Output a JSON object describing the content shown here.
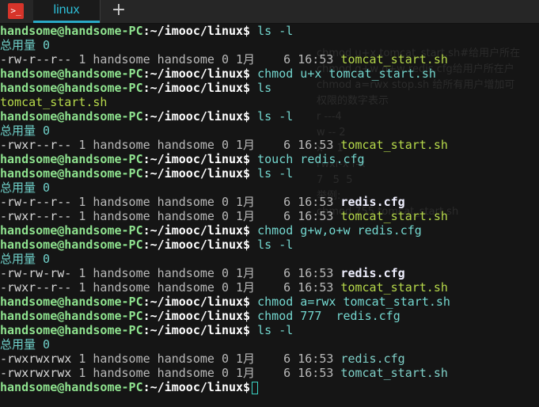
{
  "window": {
    "tab_label": "linux",
    "app_icon_glyph": ">_",
    "new_tab_glyph": "+"
  },
  "prompt": {
    "user_host": "handsome@handsome-PC",
    "path": ":~/imooc/linux$"
  },
  "background_notes": [
    "chmod u+x tomcat_start.sh#给用户所在",
    "chmod g+w,o+w redis.cfg给用户所在户",
    "chmod a=rwx stop.sh 给所有用户增加可",
    "权限的数字表示",
    "r ---4",
    "w -- 2",
    "x -- 1",
    "rwxr-x r-x",
    "7   5  5",
    "举例:",
    "chmod 755 tomcat_start.sh"
  ],
  "lines": [
    {
      "type": "prompt",
      "cmd": " ls -l"
    },
    {
      "type": "total",
      "text": "总用量 0"
    },
    {
      "type": "entry",
      "perm": "-rw-r--r--",
      "meta": " 1 handsome handsome 0 1月    6 16:53 ",
      "file": "tomcat_start.sh",
      "style": "file"
    },
    {
      "type": "prompt",
      "cmd": " chmod u+x tomcat_start.sh"
    },
    {
      "type": "prompt",
      "cmd": " ls"
    },
    {
      "type": "plain",
      "text": "tomcat_start.sh"
    },
    {
      "type": "prompt",
      "cmd": " ls -l"
    },
    {
      "type": "total",
      "text": "总用量 0"
    },
    {
      "type": "entry",
      "perm": "-rwxr--r--",
      "meta": " 1 handsome handsome 0 1月    6 16:53 ",
      "file": "tomcat_start.sh",
      "style": "file"
    },
    {
      "type": "prompt",
      "cmd": " touch redis.cfg"
    },
    {
      "type": "prompt",
      "cmd": " ls -l"
    },
    {
      "type": "total",
      "text": "总用量 0"
    },
    {
      "type": "entry",
      "perm": "-rw-r--r--",
      "meta": " 1 handsome handsome 0 1月    6 16:53 ",
      "file": "redis.cfg",
      "style": "bold-file"
    },
    {
      "type": "entry",
      "perm": "-rwxr--r--",
      "meta": " 1 handsome handsome 0 1月    6 16:53 ",
      "file": "tomcat_start.sh",
      "style": "file"
    },
    {
      "type": "prompt",
      "cmd": " chmod g+w,o+w redis.cfg"
    },
    {
      "type": "prompt",
      "cmd": " ls -l"
    },
    {
      "type": "total",
      "text": "总用量 0"
    },
    {
      "type": "entry",
      "perm": "-rw-rw-rw-",
      "meta": " 1 handsome handsome 0 1月    6 16:53 ",
      "file": "redis.cfg",
      "style": "bold-file"
    },
    {
      "type": "entry",
      "perm": "-rwxr--r--",
      "meta": " 1 handsome handsome 0 1月    6 16:53 ",
      "file": "tomcat_start.sh",
      "style": "file"
    },
    {
      "type": "prompt",
      "cmd": " chmod a=rwx tomcat_start.sh"
    },
    {
      "type": "prompt",
      "cmd": " chmod 777  redis.cfg"
    },
    {
      "type": "prompt",
      "cmd": " ls -l"
    },
    {
      "type": "total",
      "text": "总用量 0"
    },
    {
      "type": "entry",
      "perm": "-rwxrwxrwx",
      "meta": " 1 handsome handsome 0 1月    6 16:53 ",
      "file": "redis.cfg",
      "style": "plain-file"
    },
    {
      "type": "entry",
      "perm": "-rwxrwxrwx",
      "meta": " 1 handsome handsome 0 1月    6 16:53 ",
      "file": "tomcat_start.sh",
      "style": "plain-file"
    },
    {
      "type": "prompt",
      "cmd": "",
      "cursor": true
    }
  ]
}
